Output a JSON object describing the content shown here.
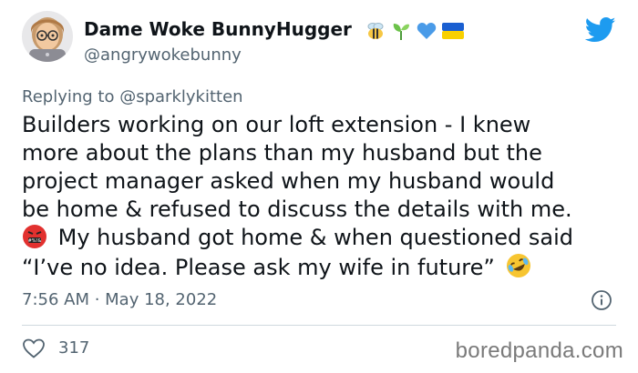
{
  "author": {
    "display_name": "Dame Woke BunnyHugger",
    "handle": "@angrywokebunny",
    "name_emoji": [
      "bee-emoji",
      "seedling-emoji",
      "blue-heart-emoji",
      "ukraine-flag-emoji"
    ]
  },
  "reply": {
    "prefix": "Replying to",
    "mention": "@sparklykitten"
  },
  "body": {
    "line1": "Builders working on our loft extension - I knew",
    "line2": "more about the plans than my husband but the",
    "line3": "project manager asked when my husband would",
    "line4": "be home & refused to discuss the details with me.",
    "line5": "My husband got home & when questioned said",
    "line6": "“I’ve no idea. Please ask my wife in future”",
    "emoji": [
      "angry-face-emoji",
      "rolling-laughing-emoji"
    ]
  },
  "meta": {
    "timestamp": "7:56 AM · May 18, 2022"
  },
  "stats": {
    "likes": "317"
  },
  "watermark": "boredpanda.com",
  "colors": {
    "twitter_blue": "#1d9bf0",
    "secondary_text": "#536471",
    "primary_text": "#0f1419"
  }
}
